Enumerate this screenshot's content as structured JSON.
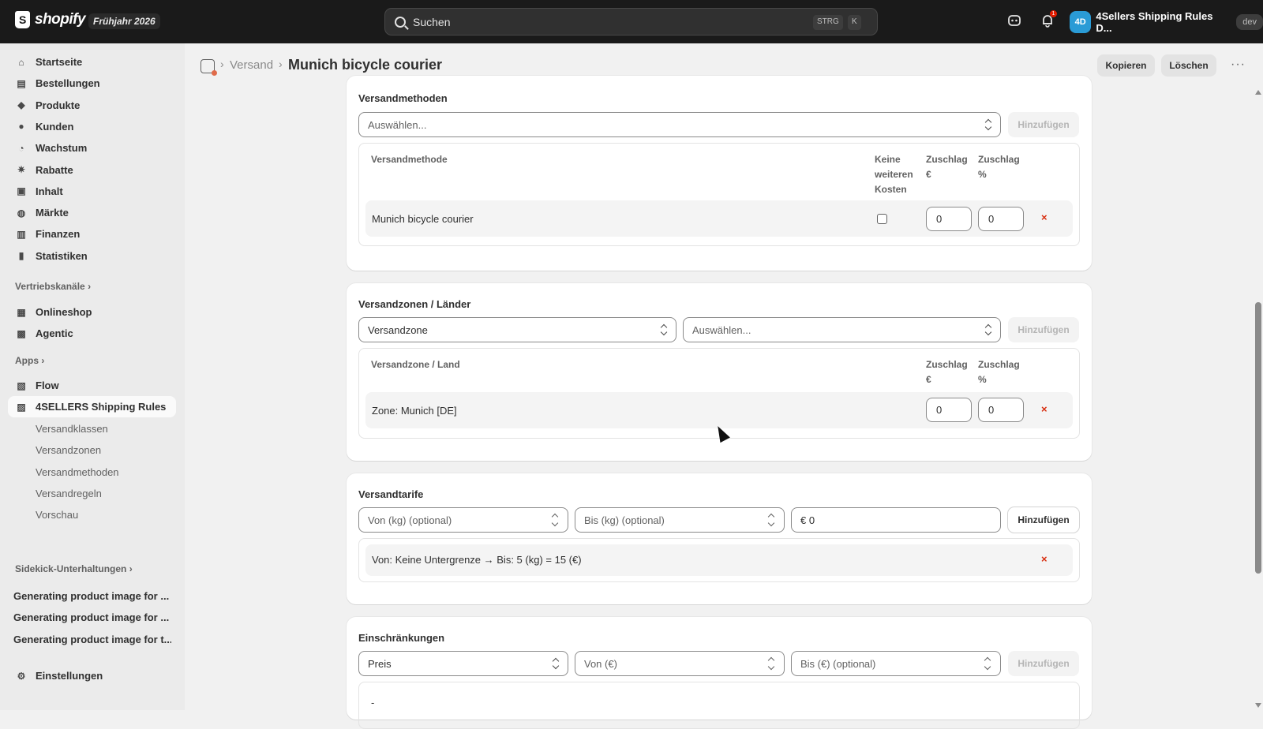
{
  "topbar": {
    "logo_text": "shopify",
    "season_badge": "Frühjahr 2026",
    "search_placeholder": "Suchen",
    "search_key1": "STRG",
    "search_key2": "K",
    "notification_count": "1",
    "store_initials": "4D",
    "store_name": "4Sellers Shipping Rules D...",
    "env_badge": "dev"
  },
  "sidebar": {
    "main_items": [
      {
        "label": "Startseite",
        "icon": "home-icon"
      },
      {
        "label": "Bestellungen",
        "icon": "orders-icon"
      },
      {
        "label": "Produkte",
        "icon": "tag-icon"
      },
      {
        "label": "Kunden",
        "icon": "person-icon"
      },
      {
        "label": "Wachstum",
        "icon": "gauge-icon"
      },
      {
        "label": "Rabatte",
        "icon": "discount-icon"
      },
      {
        "label": "Inhalt",
        "icon": "content-icon"
      },
      {
        "label": "Märkte",
        "icon": "globe-icon"
      },
      {
        "label": "Finanzen",
        "icon": "bank-icon"
      },
      {
        "label": "Statistiken",
        "icon": "bar-chart-icon"
      }
    ],
    "sales_channels_label": "Vertriebskanäle",
    "sales_channels": [
      {
        "label": "Onlineshop",
        "icon": "store-icon"
      },
      {
        "label": "Agentic",
        "icon": "agent-icon"
      }
    ],
    "apps_label": "Apps",
    "apps": [
      {
        "label": "Flow",
        "icon": "flow-icon"
      },
      {
        "label": "4SELLERS Shipping Rules",
        "icon": "app-icon"
      }
    ],
    "app_subitems": [
      "Versandklassen",
      "Versandzonen",
      "Versandmethoden",
      "Versandregeln",
      "Vorschau"
    ],
    "sidekick_label": "Sidekick-Unterhaltungen",
    "sidekick_items": [
      "Generating product image for ...",
      "Generating product image for ...",
      "Generating product image for t..."
    ],
    "settings_label": "Einstellungen"
  },
  "header": {
    "breadcrumb_link": "Versand",
    "title": "Munich bicycle courier",
    "copy_label": "Kopieren",
    "delete_label": "Löschen",
    "more_label": "···"
  },
  "methods": {
    "title": "Versandmethoden",
    "select_placeholder": "Auswählen...",
    "add_label": "Hinzufügen",
    "col_method": "Versandmethode",
    "col_no_cost": [
      "Keine",
      "weiteren",
      "Kosten"
    ],
    "col_surcharge_eur": [
      "Zuschlag",
      "€"
    ],
    "col_surcharge_pct": [
      "Zuschlag",
      "%"
    ],
    "row_name": "Munich bicycle courier",
    "row_eur": "0",
    "row_pct": "0",
    "remove": "×"
  },
  "zones": {
    "title": "Versandzonen / Länder",
    "type_select": "Versandzone",
    "select_placeholder": "Auswählen...",
    "add_label": "Hinzufügen",
    "col_zone": "Versandzone / Land",
    "col_surcharge_eur": [
      "Zuschlag",
      "€"
    ],
    "col_surcharge_pct": [
      "Zuschlag",
      "%"
    ],
    "row_name": "Zone: Munich [DE]",
    "row_eur": "0",
    "row_pct": "0",
    "remove": "×"
  },
  "rates": {
    "title": "Versandtarife",
    "from_placeholder": "Von (kg) (optional)",
    "to_placeholder": "Bis (kg) (optional)",
    "price_value": "€ 0",
    "add_label": "Hinzufügen",
    "row_text": "Von: Keine Untergrenze → Bis: 5 (kg) = 15 (€)",
    "remove": "×"
  },
  "restrictions": {
    "title": "Einschränkungen",
    "type_select": "Preis",
    "from_placeholder": "Von (€)",
    "to_placeholder": "Bis (€) (optional)",
    "add_label": "Hinzufügen",
    "empty": "-"
  }
}
